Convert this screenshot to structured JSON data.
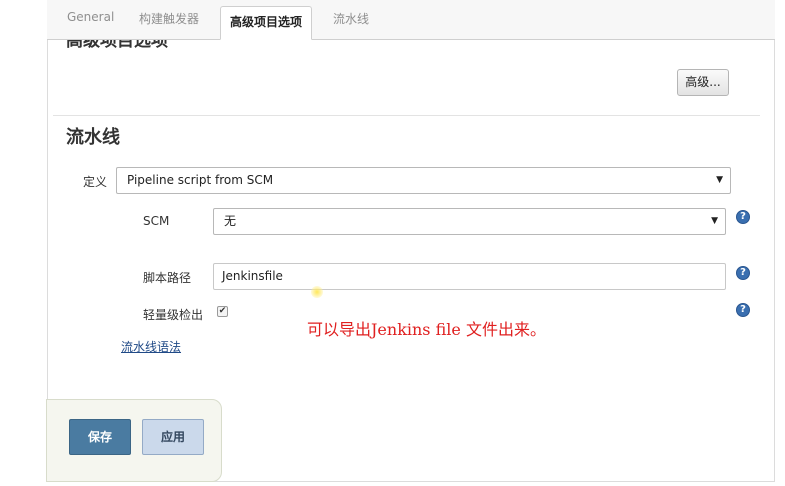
{
  "tabs": [
    {
      "label": "General"
    },
    {
      "label": "构建触发器"
    },
    {
      "label": "高级项目选项"
    },
    {
      "label": "流水线"
    }
  ],
  "advanced_section": {
    "title": "高级项目选项",
    "advanced_button": "高级..."
  },
  "pipeline": {
    "title": "流水线",
    "definition_label": "定义",
    "definition_value": "Pipeline script from SCM",
    "scm_label": "SCM",
    "scm_value": "无",
    "script_path_label": "脚本路径",
    "script_path_value": "Jenkinsfile",
    "lightweight_checkout_label": "轻量级检出",
    "lightweight_checkout_checked": true,
    "syntax_link": "流水线语法"
  },
  "annotation": "可以导出Jenkins file 文件出来。",
  "actions": {
    "save": "保存",
    "apply": "应用"
  },
  "icons": {
    "help": "help-icon",
    "dropdown": "chevron-down-icon",
    "check": "check-icon"
  },
  "colors": {
    "primary_button": "#4a7ba1",
    "secondary_button": "#cbd9eb",
    "help_icon": "#3a6fb0",
    "annotation": "#e02020",
    "link": "#204a87"
  }
}
